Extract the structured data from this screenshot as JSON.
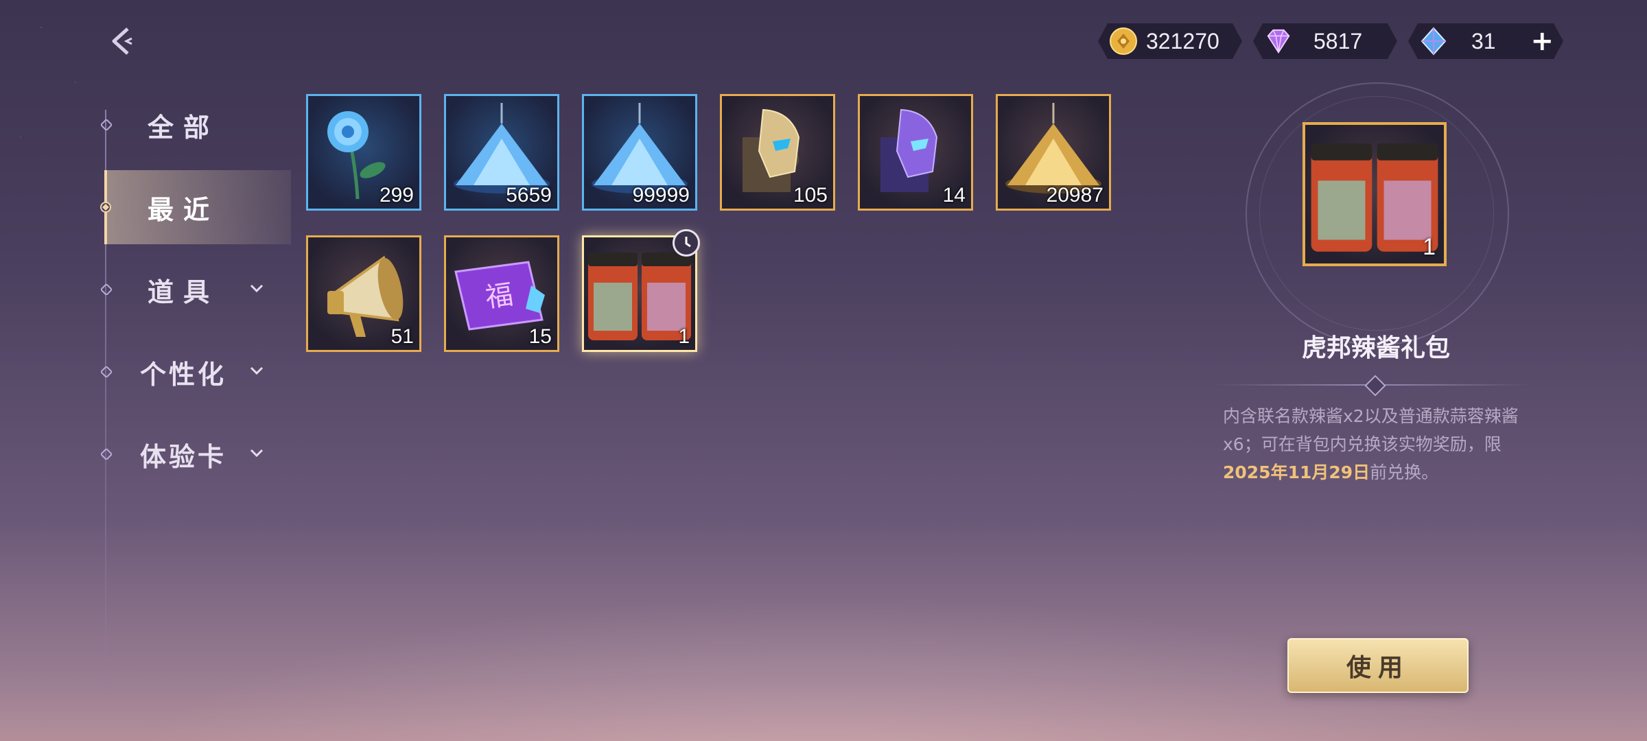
{
  "currencies": {
    "gold": {
      "value": "321270",
      "icon": "gold-coin-icon"
    },
    "diamond": {
      "value": "5817",
      "icon": "purple-diamond-icon"
    },
    "crystal": {
      "value": "31",
      "icon": "blue-crystal-icon",
      "add": "+"
    }
  },
  "sidebar": {
    "items": [
      {
        "label": "全部",
        "active": false
      },
      {
        "label": "最近",
        "active": true
      },
      {
        "label": "道具",
        "active": false,
        "expandable": true
      },
      {
        "label": "个性化",
        "active": false,
        "expandable": true
      },
      {
        "label": "体验卡",
        "active": false,
        "expandable": true
      }
    ]
  },
  "inventory": {
    "items": [
      {
        "icon": "blue-rose-icon",
        "count": "299",
        "rarity": "blue"
      },
      {
        "icon": "blue-crystal-pile-icon",
        "count": "5659",
        "rarity": "blue"
      },
      {
        "icon": "blue-crystal-pile-icon",
        "count": "99999",
        "rarity": "blue"
      },
      {
        "icon": "gold-helmet-puzzle-icon",
        "count": "105",
        "rarity": "gold"
      },
      {
        "icon": "purple-helmet-puzzle-icon",
        "count": "14",
        "rarity": "gold"
      },
      {
        "icon": "gold-crystal-pile-icon",
        "count": "20987",
        "rarity": "gold"
      },
      {
        "icon": "megaphone-icon",
        "count": "51",
        "rarity": "gold"
      },
      {
        "icon": "fu-ticket-icon",
        "count": "15",
        "rarity": "gold"
      },
      {
        "icon": "chili-sauce-jars-icon",
        "count": "1",
        "rarity": "gold",
        "selected": true,
        "timed": true
      }
    ]
  },
  "detail": {
    "count": "1",
    "title": "虎邦辣酱礼包",
    "desc_part1": "内含联名款辣酱x2以及普通款蒜蓉辣酱x6；可在背包内兑换该实物奖励，限",
    "desc_highlight": "2025年11月29日",
    "desc_part2": "前兑换。",
    "use_label": "使用"
  },
  "colors": {
    "blue_border": "#5cb4ee",
    "gold_border": "#e6ac4e",
    "highlight": "#f0c27a"
  }
}
